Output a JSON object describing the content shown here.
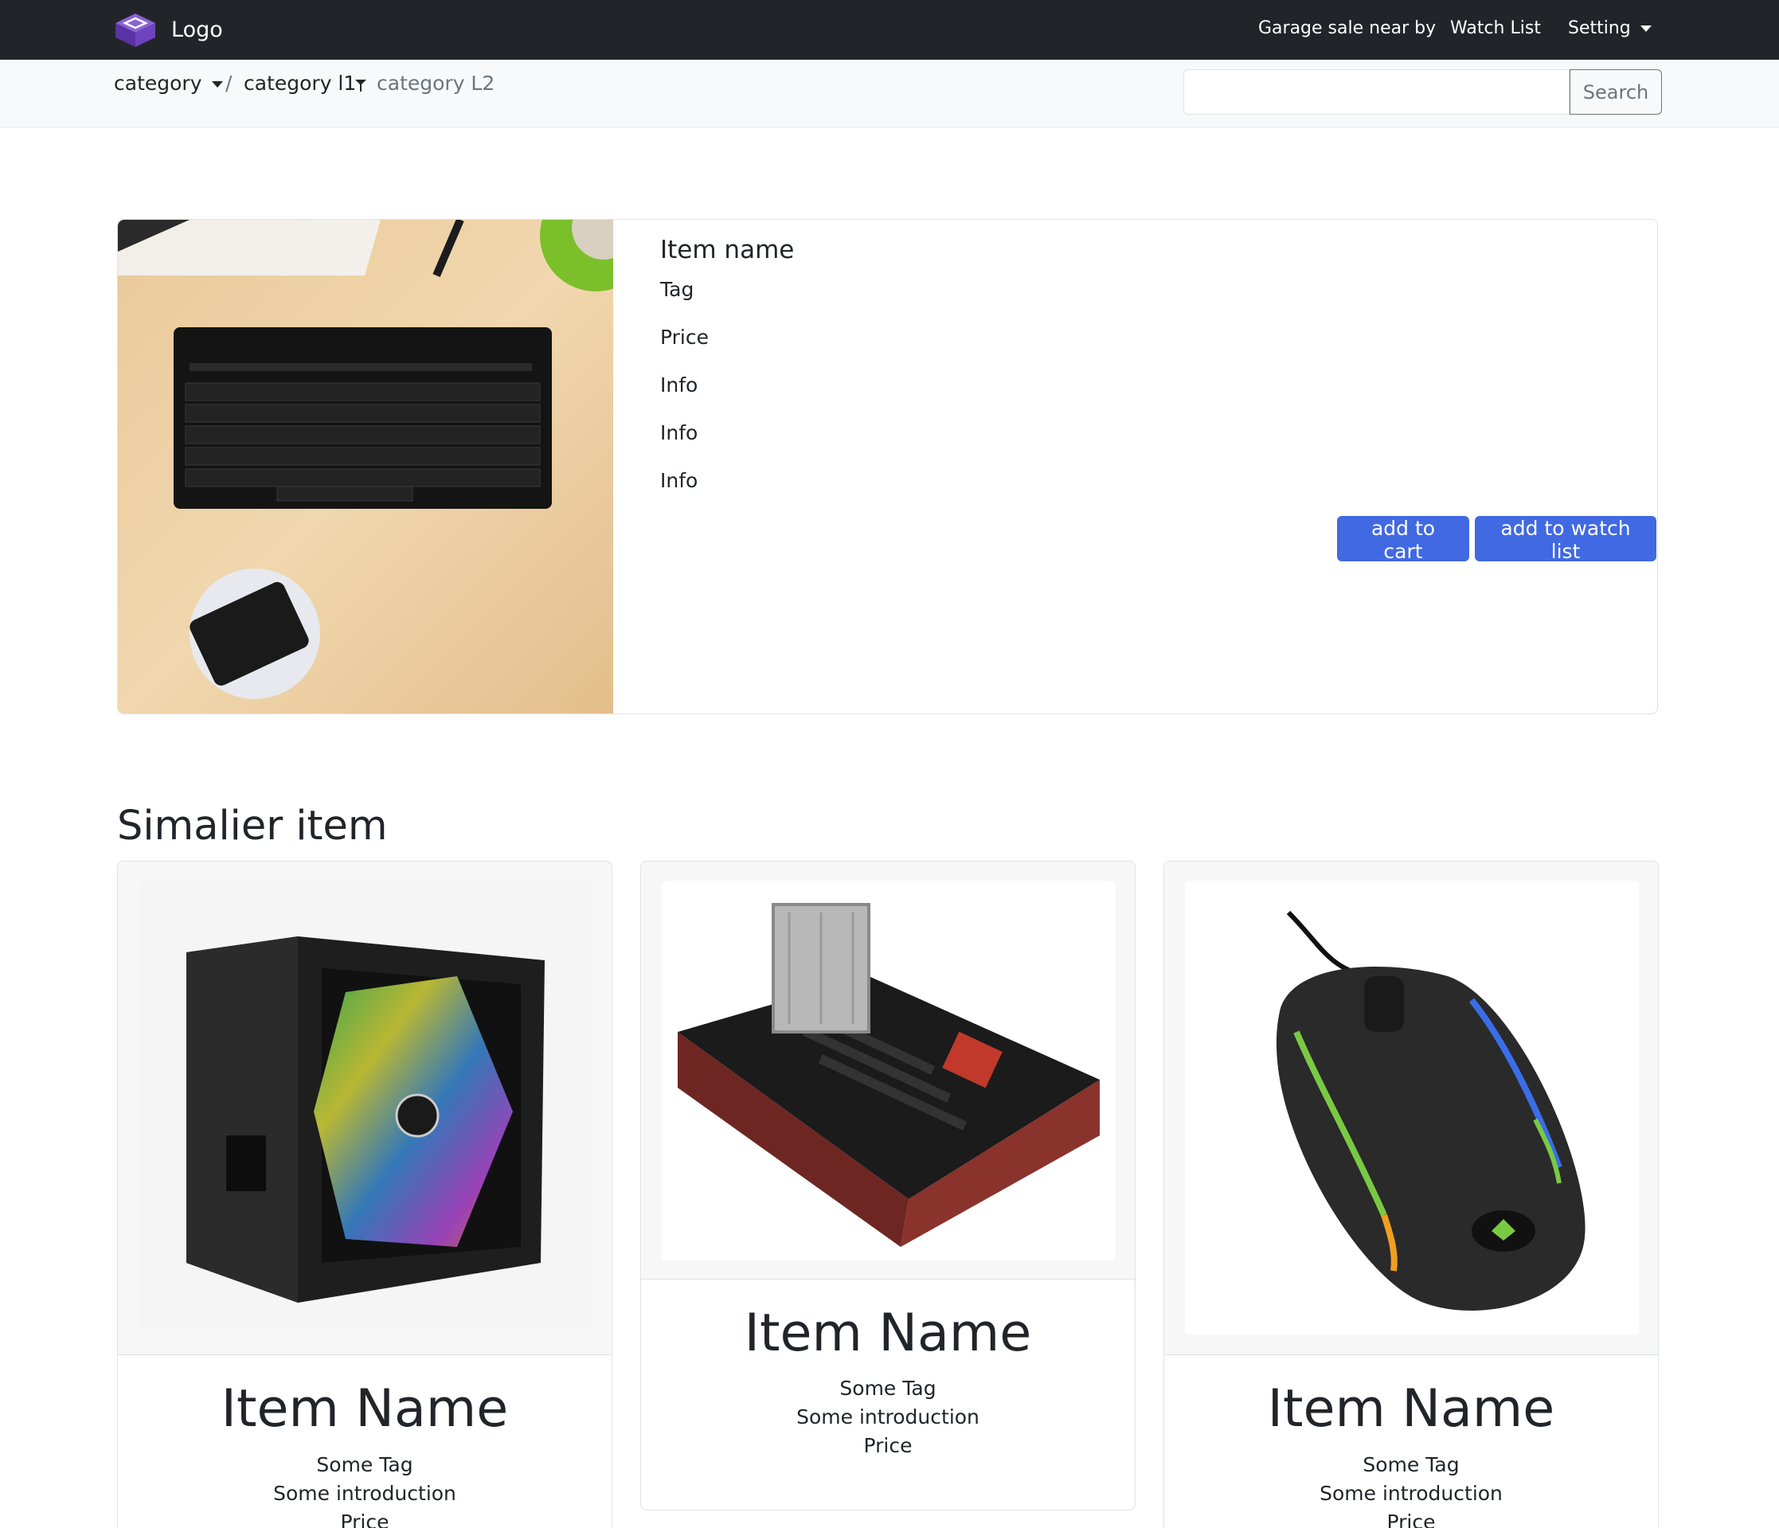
{
  "navbar": {
    "brand": "Logo",
    "links": {
      "garage_sale": "Garage sale near by",
      "watch_list": "Watch List",
      "setting": "Setting"
    }
  },
  "breadcrumb": {
    "category": "category",
    "separator": "/",
    "category_l1": "category l1",
    "category_l2": "category L2"
  },
  "search": {
    "value": "",
    "button_label": "Search"
  },
  "featured": {
    "name": "Item name",
    "tag": "Tag",
    "price": "Price",
    "info": [
      "Info",
      "Info",
      "Info"
    ],
    "add_to_cart_label": "add to cart",
    "add_to_watch_list_label": "add to watch list"
  },
  "similar": {
    "title": "Simalier item",
    "items": [
      {
        "name": "Item Name",
        "tag": "Some Tag",
        "intro": "Some introduction",
        "price": "Price"
      },
      {
        "name": "Item Name",
        "tag": "Some Tag",
        "intro": "Some introduction",
        "price": "Price"
      },
      {
        "name": "Item Name",
        "tag": "Some Tag",
        "intro": "Some introduction",
        "price": "Price"
      }
    ]
  },
  "colors": {
    "navbar_bg": "#212529",
    "primary": "#4169e1",
    "muted": "#6c757d",
    "brand_logo": "#6f42c1"
  },
  "icons": [
    "brand-logo-icon",
    "chevron-down-icon",
    "dropdown-caret-icon"
  ]
}
